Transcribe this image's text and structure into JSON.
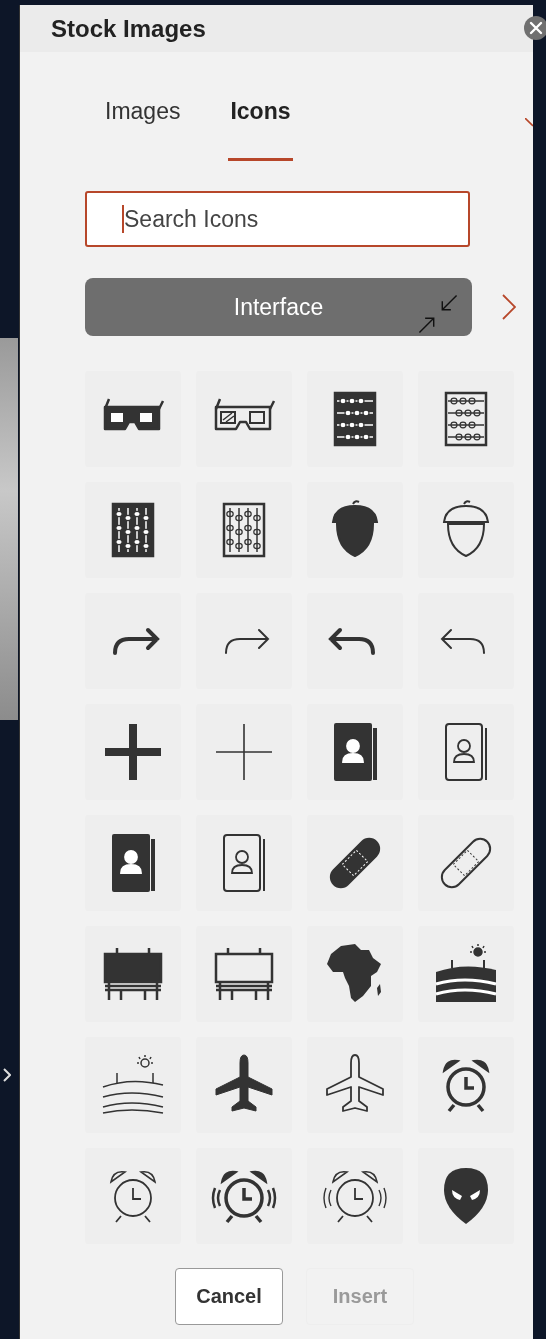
{
  "window": {
    "title": "Stock Images"
  },
  "tabs": [
    {
      "label": "Images",
      "selected": false
    },
    {
      "label": "Icons",
      "selected": true
    }
  ],
  "search": {
    "placeholder": "Search Icons"
  },
  "category": {
    "label": "Interface"
  },
  "buttons": [
    {
      "label": "Cancel",
      "disabled": false
    },
    {
      "label": "Insert",
      "disabled": true
    }
  ]
}
